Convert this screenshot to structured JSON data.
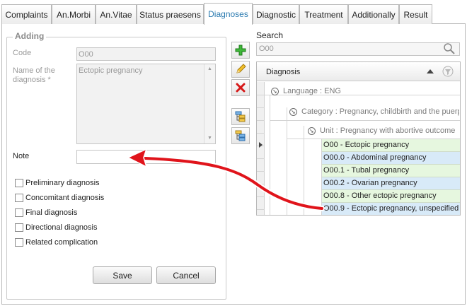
{
  "tabs": [
    {
      "label": "Complaints",
      "active": false
    },
    {
      "label": "An.Morbi",
      "active": false
    },
    {
      "label": "An.Vitae",
      "active": false
    },
    {
      "label": "Status praesens",
      "active": false
    },
    {
      "label": "Diagnoses",
      "active": true
    },
    {
      "label": "Diagnostic",
      "active": false
    },
    {
      "label": "Treatment",
      "active": false
    },
    {
      "label": "Additionally",
      "active": false
    },
    {
      "label": "Result",
      "active": false
    }
  ],
  "form": {
    "legend": "Adding",
    "code_label": "Code",
    "code_value": "O00",
    "name_label": "Name of the diagnosis *",
    "name_value": "Ectopic pregnancy",
    "note_label": "Note",
    "note_value": "",
    "checkboxes": [
      {
        "label": "Preliminary diagnosis",
        "checked": false
      },
      {
        "label": "Concomitant diagnosis",
        "checked": false
      },
      {
        "label": "Final diagnosis",
        "checked": false
      },
      {
        "label": "Directional diagnosis",
        "checked": false
      },
      {
        "label": "Related complication",
        "checked": false
      }
    ],
    "save_label": "Save",
    "cancel_label": "Cancel"
  },
  "toolbar": {
    "icons": [
      "add-icon",
      "edit-pencil-icon",
      "delete-icon",
      "expand-tree-icon",
      "collapse-tree-icon"
    ]
  },
  "search": {
    "label": "Search",
    "value": "O00"
  },
  "grid": {
    "column_header": "Diagnosis",
    "sort": "ascending",
    "groups": [
      "Language : ENG",
      "Category : Pregnancy, childbirth and the puerperium",
      "Unit : Pregnancy with abortive outcome"
    ],
    "rows": [
      {
        "text": "O00 - Ectopic pregnancy",
        "color": "green"
      },
      {
        "text": "O00.0 - Abdominal pregnancy",
        "color": "blue"
      },
      {
        "text": "O00.1 - Tubal pregnancy",
        "color": "green"
      },
      {
        "text": "O00.2 - Ovarian pregnancy",
        "color": "blue"
      },
      {
        "text": "O00.8 - Other ectopic pregnancy",
        "color": "green"
      },
      {
        "text": "O00.9 - Ectopic pregnancy, unspecified",
        "color": "blue"
      }
    ]
  },
  "colors": {
    "active_tab_text": "#2a7ab0",
    "row_green": "#e6f7df",
    "row_blue": "#d8eaf8",
    "arrow": "#e0141b"
  }
}
